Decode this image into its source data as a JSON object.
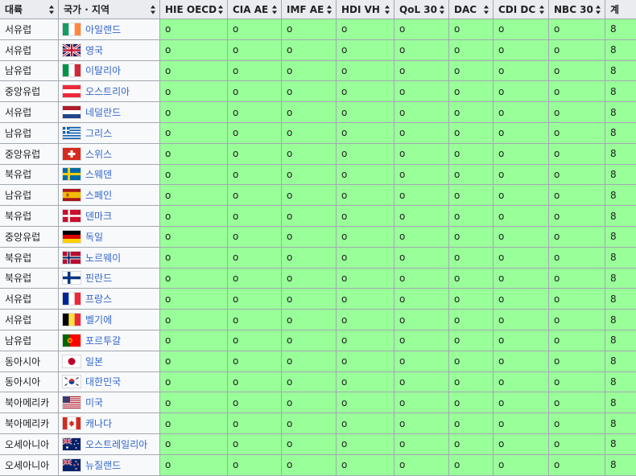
{
  "headers": [
    {
      "label": "대륙",
      "name": "header-continent",
      "sortable": true
    },
    {
      "label": "국가 · 지역",
      "name": "header-country",
      "sortable": true
    },
    {
      "label": "HIE OECD",
      "name": "header-hie-oecd",
      "sortable": true
    },
    {
      "label": "CIA AE",
      "name": "header-cia-ae",
      "sortable": true
    },
    {
      "label": "IMF AE",
      "name": "header-imf-ae",
      "sortable": true
    },
    {
      "label": "HDI VH",
      "name": "header-hdi-vh",
      "sortable": true
    },
    {
      "label": "QoL 30",
      "name": "header-qol-30",
      "sortable": true
    },
    {
      "label": "DAC",
      "name": "header-dac",
      "sortable": true
    },
    {
      "label": "CDI DC",
      "name": "header-cdi-dc",
      "sortable": true
    },
    {
      "label": "NBC 30",
      "name": "header-nbc-30",
      "sortable": true
    },
    {
      "label": "계",
      "name": "header-total",
      "sortable": false
    }
  ],
  "mark_symbol": "o",
  "colors": {
    "header_bg": "#eaecf0",
    "mark_bg": "#99ff99",
    "link": "#3366cc",
    "border": "#a2a9b1"
  },
  "rows": [
    {
      "region": "서유럽",
      "country": "아일랜드",
      "flag": "ireland-flag",
      "total": "8"
    },
    {
      "region": "서유럽",
      "country": "영국",
      "flag": "uk-flag",
      "total": "8"
    },
    {
      "region": "남유럽",
      "country": "이탈리아",
      "flag": "italy-flag",
      "total": "8"
    },
    {
      "region": "중앙유럽",
      "country": "오스트리아",
      "flag": "austria-flag",
      "total": "8"
    },
    {
      "region": "서유럽",
      "country": "네덜란드",
      "flag": "netherlands-flag",
      "total": "8"
    },
    {
      "region": "남유럽",
      "country": "그리스",
      "flag": "greece-flag",
      "total": "8"
    },
    {
      "region": "중앙유럽",
      "country": "스위스",
      "flag": "switzerland-flag",
      "total": "8"
    },
    {
      "region": "북유럽",
      "country": "스웨덴",
      "flag": "sweden-flag",
      "total": "8"
    },
    {
      "region": "남유럽",
      "country": "스페인",
      "flag": "spain-flag",
      "total": "8"
    },
    {
      "region": "북유럽",
      "country": "덴마크",
      "flag": "denmark-flag",
      "total": "8"
    },
    {
      "region": "중앙유럽",
      "country": "독일",
      "flag": "germany-flag",
      "total": "8"
    },
    {
      "region": "북유럽",
      "country": "노르웨이",
      "flag": "norway-flag",
      "total": "8"
    },
    {
      "region": "북유럽",
      "country": "핀란드",
      "flag": "finland-flag",
      "total": "8"
    },
    {
      "region": "서유럽",
      "country": "프랑스",
      "flag": "france-flag",
      "total": "8"
    },
    {
      "region": "서유럽",
      "country": "벨기에",
      "flag": "belgium-flag",
      "total": "8"
    },
    {
      "region": "남유럽",
      "country": "포르투갈",
      "flag": "portugal-flag",
      "total": "8"
    },
    {
      "region": "동아시아",
      "country": "일본",
      "flag": "japan-flag",
      "total": "8"
    },
    {
      "region": "동아시아",
      "country": "대한민국",
      "flag": "south-korea-flag",
      "total": "8"
    },
    {
      "region": "북아메리카",
      "country": "미국",
      "flag": "usa-flag",
      "total": "8"
    },
    {
      "region": "북아메리카",
      "country": "캐나다",
      "flag": "canada-flag",
      "total": "8"
    },
    {
      "region": "오세아니아",
      "country": "오스트레일리아",
      "flag": "australia-flag",
      "total": "8"
    },
    {
      "region": "오세아니아",
      "country": "뉴질랜드",
      "flag": "new-zealand-flag",
      "total": "8"
    }
  ]
}
